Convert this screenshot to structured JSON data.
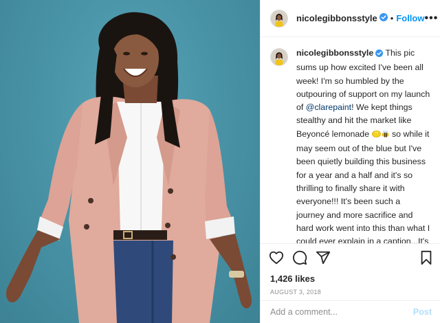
{
  "post": {
    "username": "nicolegibbonsstyle",
    "follow_label": "Follow",
    "dot": "•",
    "more_label": "•••",
    "image_alt": "Smiling woman in a pink blazer, white shirt and jeans against a teal background"
  },
  "caption": {
    "username": "nicolegibbonsstyle",
    "text_1": " This pic sums up how excited I've been all week! I'm so humbled by the outpouring of support on my launch of ",
    "mention": "@clarepaint",
    "text_2": "! We kept things stealthy and hit the market like Beyoncé lemonade ",
    "text_3": " so while it may seem out of the blue but I've been quietly building this business for a year and a half and it's so thrilling to finally share it with everyone!!! It's been such a journey and more sacrifice and hard work went into this than what I could ever explain in a caption...It's by far my most significant accomplishment. I've been seriously emotional over here reading all of your comments and well-wishes and am doing my best to reply back to everyone! And"
  },
  "stats": {
    "likes": "1,426 likes",
    "date": "AUGUST 3, 2018"
  },
  "comment_box": {
    "placeholder": "Add a comment...",
    "post_label": "Post"
  },
  "icons": [
    "heart-icon",
    "comment-icon",
    "share-icon",
    "bookmark-icon",
    "verified-badge-icon",
    "lemon-emoji",
    "bee-emoji"
  ],
  "colors": {
    "accent": "#0095f6",
    "background_teal": "#4a94a8",
    "blazer_pink": "#e0aa9c",
    "post_disabled": "#b2dffc"
  }
}
